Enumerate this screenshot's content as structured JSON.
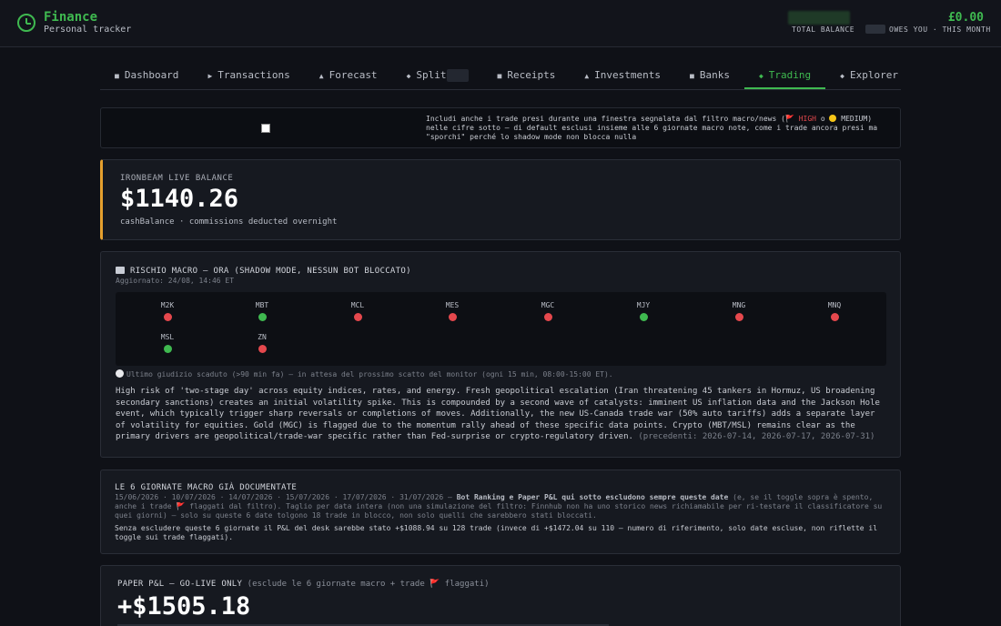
{
  "header": {
    "title": "Finance",
    "subtitle": "Personal tracker",
    "total_balance_label": "TOTAL BALANCE",
    "owes_amount": "£0.00",
    "owes_label": "OWES YOU · THIS MONTH",
    "logo_icon": "clock-icon",
    "accent_color": "#3fb950"
  },
  "nav": {
    "items": [
      {
        "icon": "■",
        "label": "Dashboard"
      },
      {
        "icon": "▶",
        "label": "Transactions"
      },
      {
        "icon": "▲",
        "label": "Forecast"
      },
      {
        "icon": "◆",
        "label": "Split"
      },
      {
        "icon": "■",
        "label": "Receipts"
      },
      {
        "icon": "▲",
        "label": "Investments"
      },
      {
        "icon": "■",
        "label": "Banks"
      },
      {
        "icon": "◆",
        "label": "Trading"
      },
      {
        "icon": "◆",
        "label": "Explorer"
      }
    ],
    "active": "Trading"
  },
  "toggle": {
    "text_a": "Includi anche i trade presi durante una finestra segnalata dal filtro macro/news (",
    "high": "🚩 HIGH",
    "text_b": " o ",
    "medium": "MEDIUM",
    "text_c": ") nelle cifre sotto — di default esclusi insieme alle 6 giornate macro note, come i trade ancora presi ma \"sporchi\" perché lo shadow mode non blocca nulla",
    "checked": false
  },
  "balance": {
    "label": "IRONBEAM LIVE BALANCE",
    "value": "$1140.26",
    "note": "cashBalance · commissions deducted overnight",
    "accent": "#e5a02e"
  },
  "macro": {
    "title": "RISCHIO MACRO — ORA (SHADOW MODE, NESSUN BOT BLOCCATO)",
    "updated": "Aggiornato: 24/08, 14:46 ET",
    "tickers": [
      {
        "name": "M2K",
        "status": "red"
      },
      {
        "name": "MBT",
        "status": "green"
      },
      {
        "name": "MCL",
        "status": "red"
      },
      {
        "name": "MES",
        "status": "red"
      },
      {
        "name": "MGC",
        "status": "red"
      },
      {
        "name": "MJY",
        "status": "green"
      },
      {
        "name": "MNG",
        "status": "red"
      },
      {
        "name": "MNQ",
        "status": "red"
      },
      {
        "name": "MSL",
        "status": "green"
      },
      {
        "name": "ZN",
        "status": "red"
      }
    ],
    "colors": {
      "red": "#e5484d",
      "green": "#3fb950"
    },
    "expired_note": "Ultimo giudizio scaduto (>90 min fa) — in attesa del prossimo scatto del monitor (ogni 15 min, 08:00-15:00 ET).",
    "body": "High risk of 'two-stage day' across equity indices, rates, and energy. Fresh geopolitical escalation (Iran threatening 45 tankers in Hormuz, US broadening secondary sanctions) creates an initial volatility spike. This is compounded by a second wave of catalysts: imminent US inflation data and the Jackson Hole event, which typically trigger sharp reversals or completions of moves. Additionally, the new US-Canada trade war (50% auto tariffs) adds a separate layer of volatility for equities. Gold (MGC) is flagged due to the momentum rally ahead of these specific data points. Crypto (MBT/MSL) remains clear as the primary drivers are geopolitical/trade-war specific rather than Fed-surprise or crypto-regulatory driven.",
    "previous": "(precedenti: 2026-07-14, 2026-07-17, 2026-07-31)"
  },
  "days": {
    "title": "LE 6 GIORNATE MACRO GIÀ DOCUMENTATE",
    "dates": "15/06/2026 · 10/07/2026 · 14/07/2026 · 15/07/2026 · 17/07/2026 · 31/07/2026 — ",
    "bold": "Bot Ranking e Paper P&L qui sotto escludono sempre queste date",
    "rest_a": " (e, se il toggle sopra è spento, anche i trade ",
    "rest_flag": "🚩",
    "rest_b": " flaggati dal filtro). Taglio per data intera (non una simulazione del filtro: Finnhub non ha uno storico news richiamabile per ri-testare il classificatore su quei giorni) — solo su queste 6 date tolgono 18 trade in blocco, non solo quelli che sarebbero stati bloccati.",
    "summary": "Senza escludere queste 6 giornate il P&L del desk sarebbe stato +$1088.94 su 128 trade (invece di +$1472.04 su 110 — numero di riferimento, solo date escluse, non riflette il toggle sui trade flaggati)."
  },
  "pnl": {
    "title": "PAPER P&L — GO-LIVE ONLY",
    "title_note": " (esclude le 6 giornate macro + trade 🚩 flaggati)",
    "value": "+$1505.18"
  }
}
